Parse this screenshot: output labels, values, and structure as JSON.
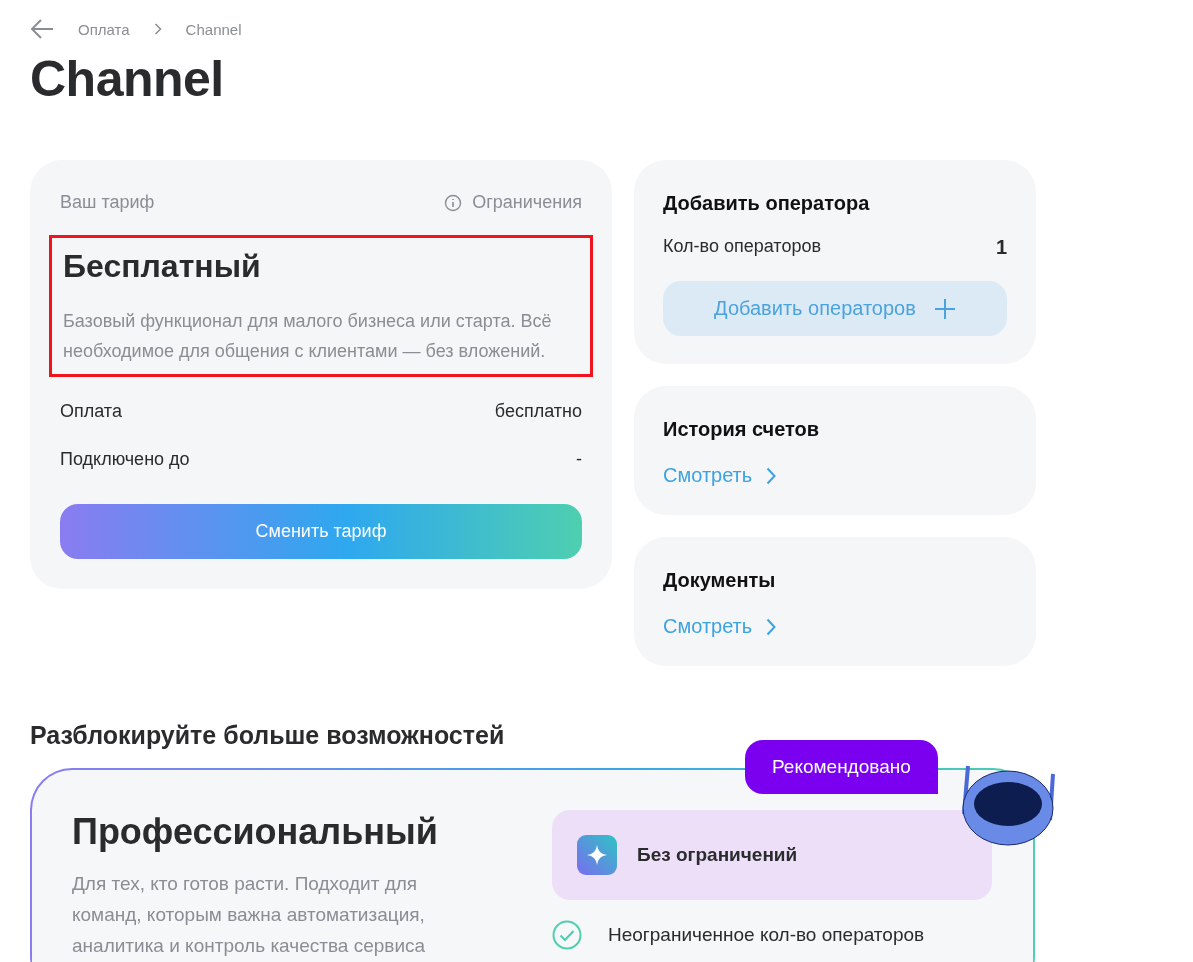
{
  "breadcrumb": {
    "items": [
      {
        "label": "Оплата"
      },
      {
        "label": "Channel"
      }
    ]
  },
  "page_title": "Channel",
  "current_plan": {
    "label": "Ваш тариф",
    "limits_link": "Ограничения",
    "name": "Бесплатный",
    "description": "Базовый функционал для малого бизнеса или старта. Всё необходимое для общения с клиентами — без вложений.",
    "highlighted": true,
    "rows": [
      {
        "label": "Оплата",
        "value": "бесплатно"
      },
      {
        "label": "Подключено до",
        "value": "-"
      }
    ],
    "button": "Сменить тариф"
  },
  "side_cards": [
    {
      "kind": "operators",
      "title": "Добавить оператора",
      "count_label": "Кол-во операторов",
      "count": "1",
      "button": "Добавить операторов"
    },
    {
      "kind": "link",
      "title": "История счетов",
      "link": "Смотреть"
    },
    {
      "kind": "link",
      "title": "Документы",
      "link": "Смотреть"
    }
  ],
  "upsell": {
    "heading": "Разблокируйте больше возможностей",
    "plan": {
      "badge": "Рекомендовано",
      "name": "Профессиональный",
      "description": "Для тех, кто готов расти. Подходит для команд, которым важна автоматизация, аналитика и контроль качества сервиса",
      "highlight": "Без ограничений",
      "features": [
        {
          "label": "Неограниченное кол-во операторов",
          "checked": true
        }
      ]
    }
  }
}
